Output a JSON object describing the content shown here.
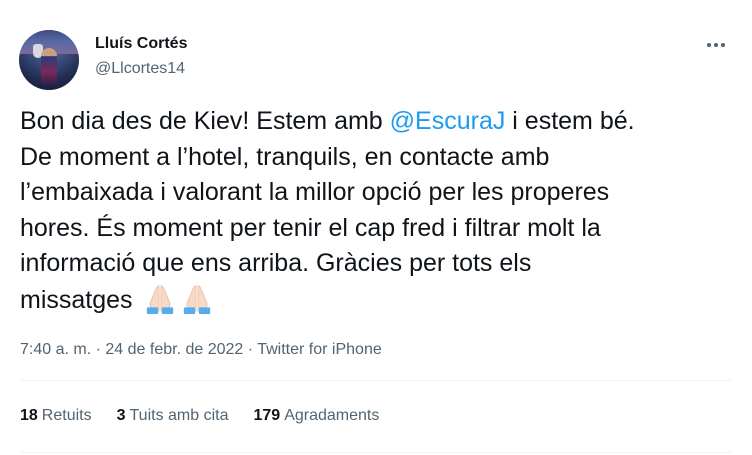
{
  "author": {
    "name": "Lluís Cortés",
    "handle": "@Llcortes14"
  },
  "tweet": {
    "lines": [
      {
        "before": "Bon dia des de Kiev! Estem amb ",
        "mention": "@EscuraJ",
        "after": " i estem bé."
      },
      {
        "text": "De moment a l’hotel, tranquils, en contacte amb"
      },
      {
        "text": "l’embaixada i valorant la millor opció per les properes"
      },
      {
        "text": "hores. És moment per tenir el cap fred i filtrar molt la"
      },
      {
        "text": "informació que ens arriba. Gràcies per tots els"
      },
      {
        "text": "missatges"
      }
    ],
    "emojis": [
      "folded-hands-icon",
      "folded-hands-icon"
    ]
  },
  "meta": {
    "time": "7:40 a. m.",
    "separator": "·",
    "date": "24 de febr. de 2022",
    "source": "Twitter for iPhone"
  },
  "stats": {
    "retweets_count": "18",
    "retweets_label": "Retuits",
    "quotes_count": "3",
    "quotes_label": "Tuits amb cita",
    "likes_count": "179",
    "likes_label": "Agradaments"
  },
  "colors": {
    "text": "#0f1419",
    "secondary": "#536471",
    "link": "#1d9bf0",
    "divider": "#eff3f4"
  }
}
